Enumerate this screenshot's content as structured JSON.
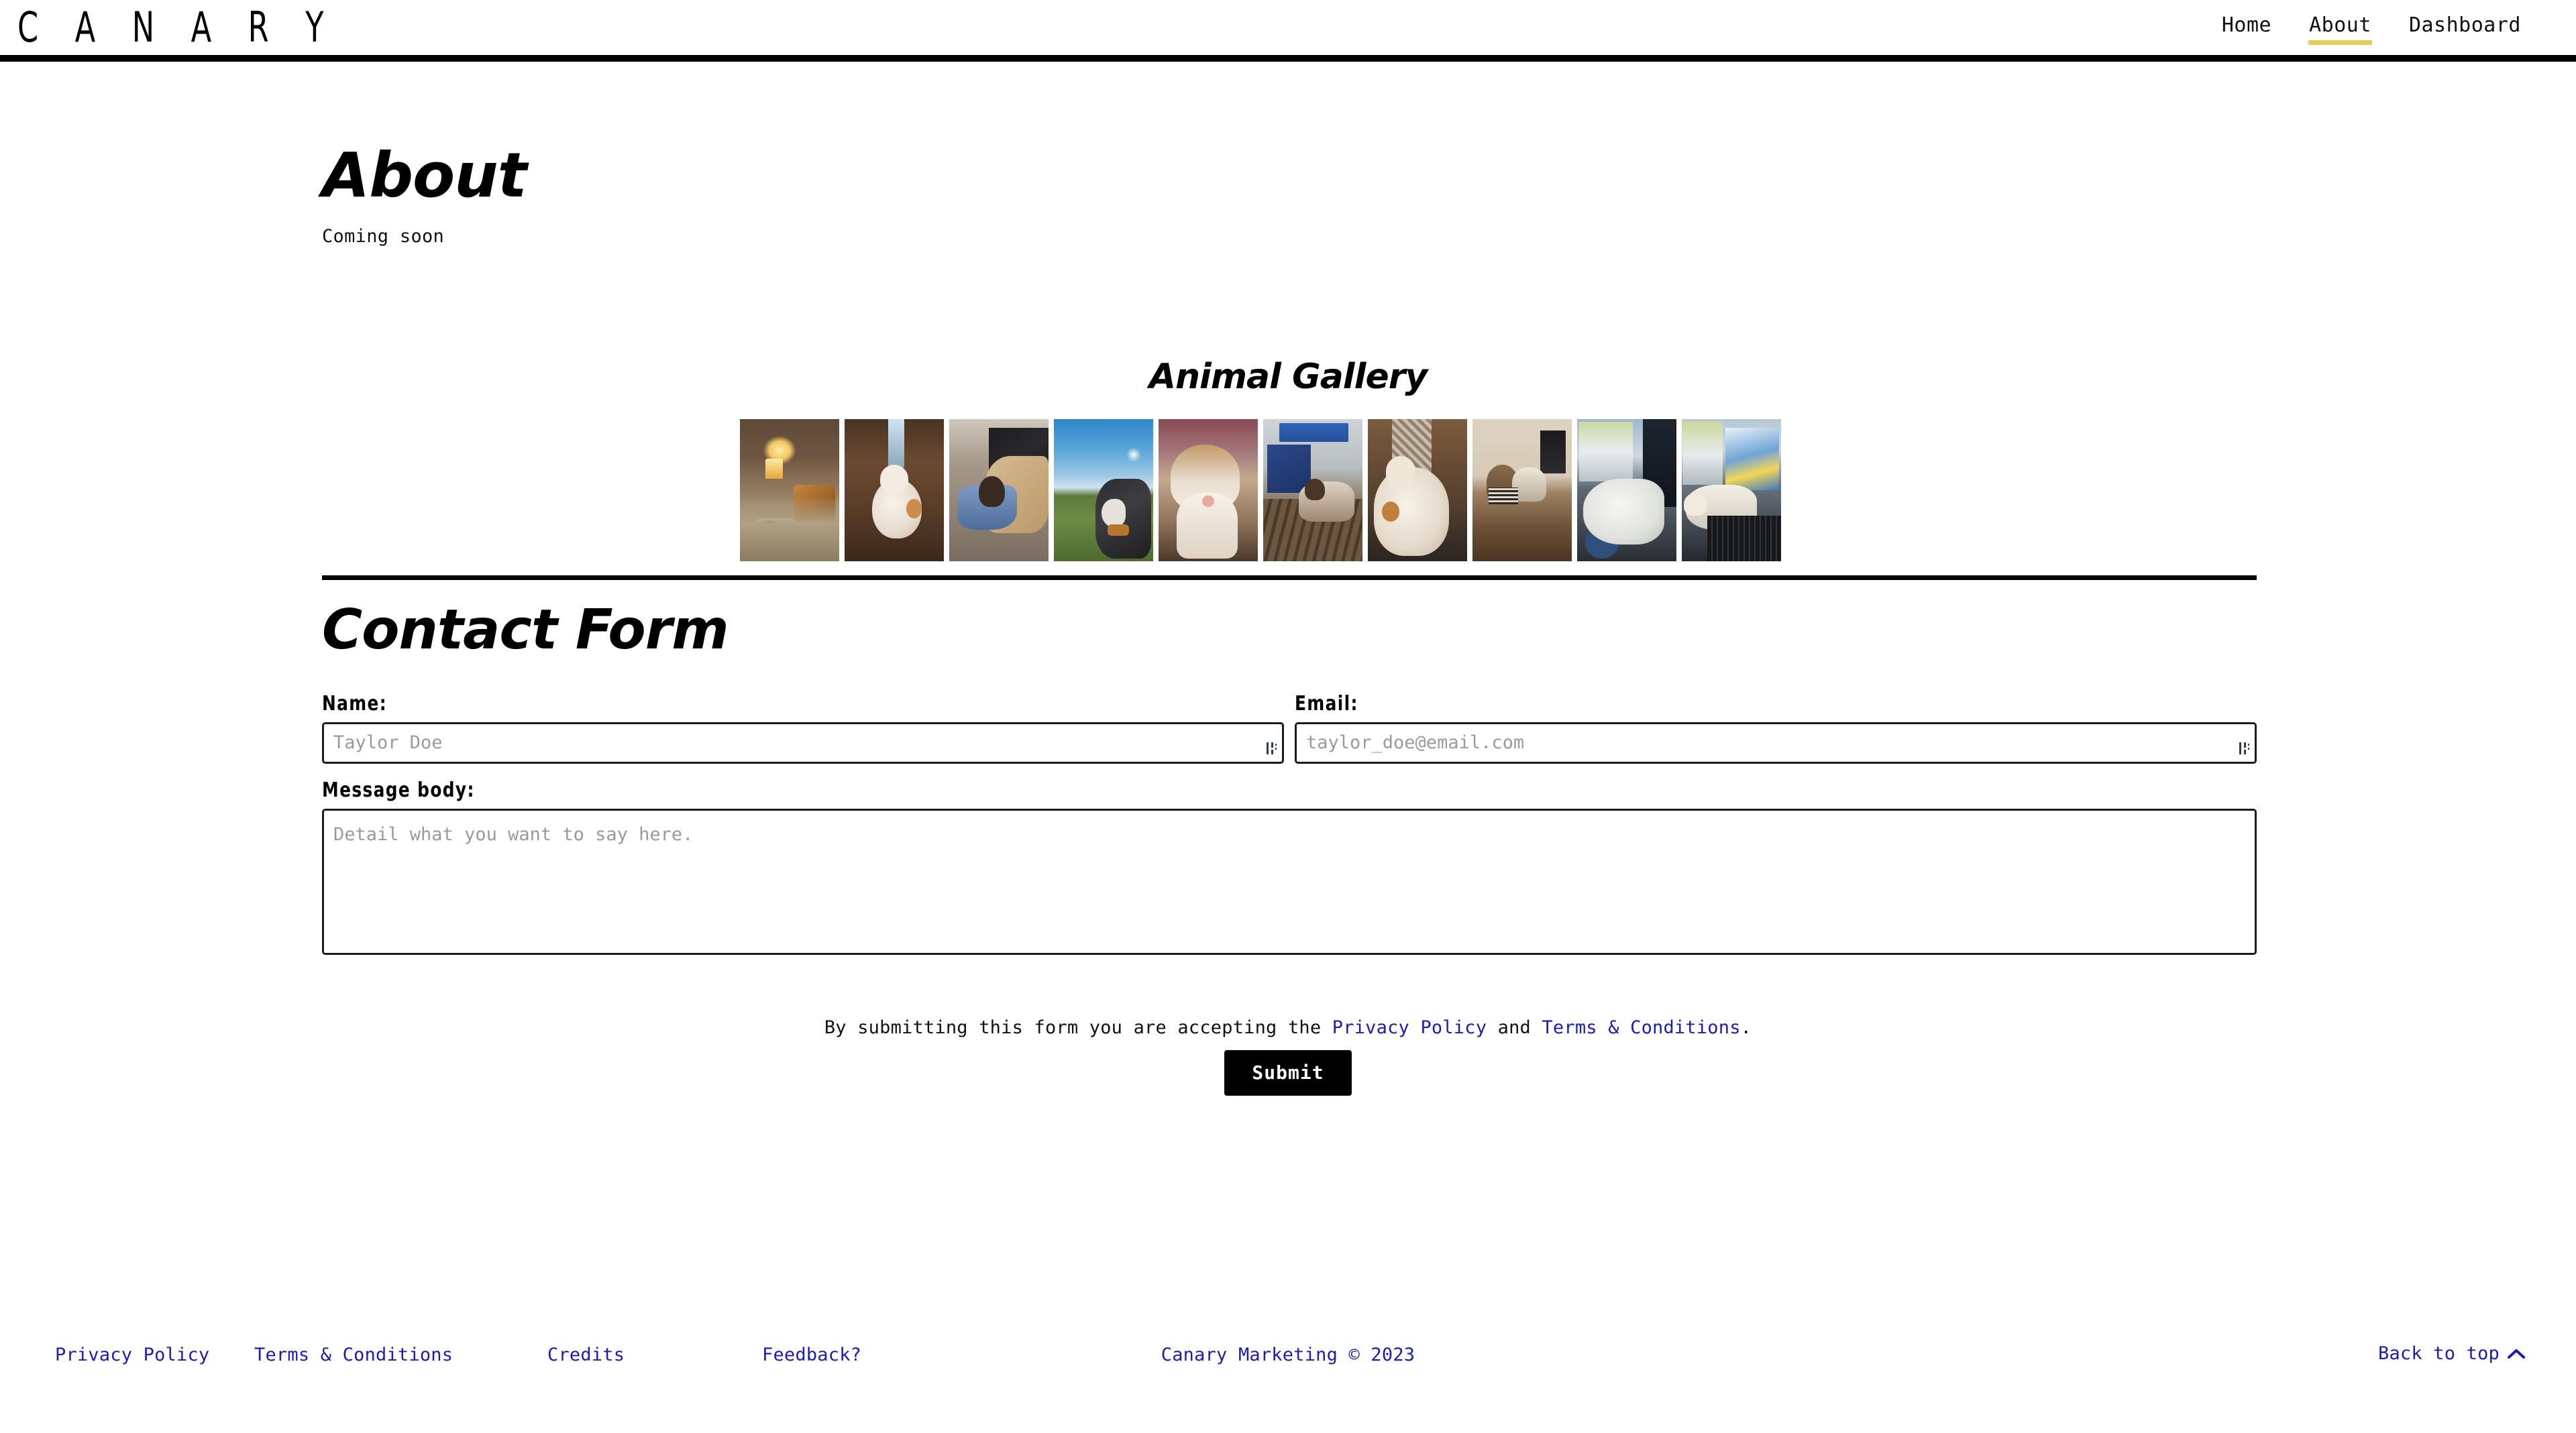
{
  "header": {
    "brand": "C A N A R Y",
    "nav": [
      {
        "label": "Home",
        "active": false
      },
      {
        "label": "About",
        "active": true
      },
      {
        "label": "Dashboard",
        "active": false
      }
    ],
    "active_accent": "#e8cc55"
  },
  "about": {
    "title": "About",
    "body": "Coming soon"
  },
  "gallery": {
    "title": "Animal Gallery",
    "images": [
      {
        "alt": "Cat sleeping on a bed in a warm lamp-lit living room"
      },
      {
        "alt": "White and ginger cat curled on a brown leather armchair"
      },
      {
        "alt": "Dog nestled in a blue blanket on a pile of laundry"
      },
      {
        "alt": "Black and white dog outdoors in a grassy field at sunset"
      },
      {
        "alt": "Ginger and white cat sleeping close-up"
      },
      {
        "alt": "Siamese cat resting on a wooden bench near street signs"
      },
      {
        "alt": "Ginger and white cat curled up asleep on a patterned rug"
      },
      {
        "alt": "Teddy bear and dog lying together on a bed"
      },
      {
        "alt": "White cat stretching on a desk beside a sunny window"
      },
      {
        "alt": "White cat lying across a computer keyboard at a desk"
      }
    ]
  },
  "contact": {
    "title": "Contact Form",
    "fields": {
      "name": {
        "label": "Name:",
        "value": "",
        "placeholder": "Taylor Doe"
      },
      "email": {
        "label": "Email:",
        "value": "",
        "placeholder": "taylor_doe@email.com"
      },
      "message": {
        "label": "Message body:",
        "value": "",
        "placeholder": "Detail what you want to say here."
      }
    },
    "consent": {
      "prefix": "By submitting this form you are accepting the ",
      "privacy_link": "Privacy Policy",
      "conjunction": " and ",
      "terms_link": "Terms & Conditions",
      "suffix": "."
    },
    "submit_label": "Submit"
  },
  "footer": {
    "links": [
      {
        "label": "Privacy Policy"
      },
      {
        "label": "Terms & Conditions"
      },
      {
        "label": "Credits"
      },
      {
        "label": "Feedback?"
      }
    ],
    "copyright": "Canary Marketing © 2023",
    "back_to_top": "Back to top",
    "link_color": "#1c1cb0"
  }
}
